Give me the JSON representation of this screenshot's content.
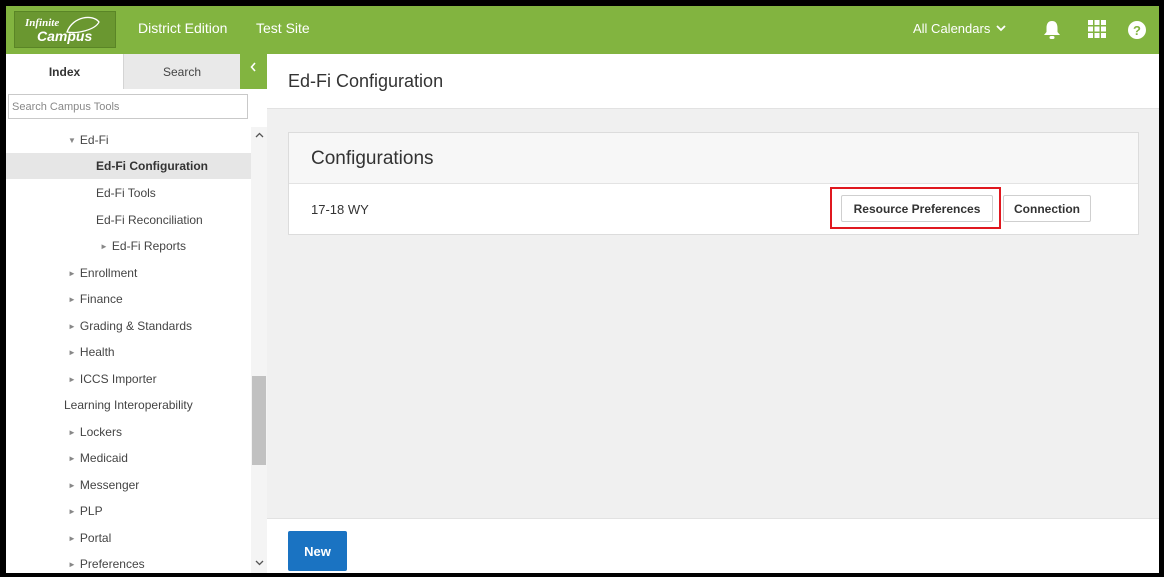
{
  "topbar": {
    "logo_line1": "Infinite",
    "logo_line2": "Campus",
    "edition": "District Edition",
    "site": "Test Site",
    "calendar_selector": "All Calendars",
    "icons": [
      "bell-icon",
      "apps-grid-icon",
      "help-icon"
    ],
    "accent_color": "#82b440"
  },
  "sidebar": {
    "tabs": [
      {
        "label": "Index",
        "active": true
      },
      {
        "label": "Search",
        "active": false
      }
    ],
    "search_placeholder": "Search Campus Tools",
    "items": [
      {
        "label": "Ed-Fi",
        "expanded": true
      },
      {
        "label": "Ed-Fi Configuration",
        "active": true
      },
      {
        "label": "Ed-Fi Tools"
      },
      {
        "label": "Ed-Fi Reconciliation"
      },
      {
        "label": "Ed-Fi Reports",
        "collapsed": true
      },
      {
        "label": "Enrollment",
        "collapsed": true
      },
      {
        "label": "Finance",
        "collapsed": true
      },
      {
        "label": "Grading & Standards",
        "collapsed": true
      },
      {
        "label": "Health",
        "collapsed": true
      },
      {
        "label": "ICCS Importer",
        "collapsed": true
      },
      {
        "label": "Learning Interoperability"
      },
      {
        "label": "Lockers",
        "collapsed": true
      },
      {
        "label": "Medicaid",
        "collapsed": true
      },
      {
        "label": "Messenger",
        "collapsed": true
      },
      {
        "label": "PLP",
        "collapsed": true
      },
      {
        "label": "Portal",
        "collapsed": true
      },
      {
        "label": "Preferences",
        "collapsed": true
      }
    ]
  },
  "main": {
    "page_title": "Ed-Fi Configuration",
    "panel_title": "Configurations",
    "configurations": [
      {
        "name": "17-18 WY",
        "buttons": [
          "Resource Preferences",
          "Connection"
        ]
      }
    ],
    "new_button": "New",
    "highlight_color": "#e0181f",
    "primary_button_color": "#1a73c2"
  }
}
